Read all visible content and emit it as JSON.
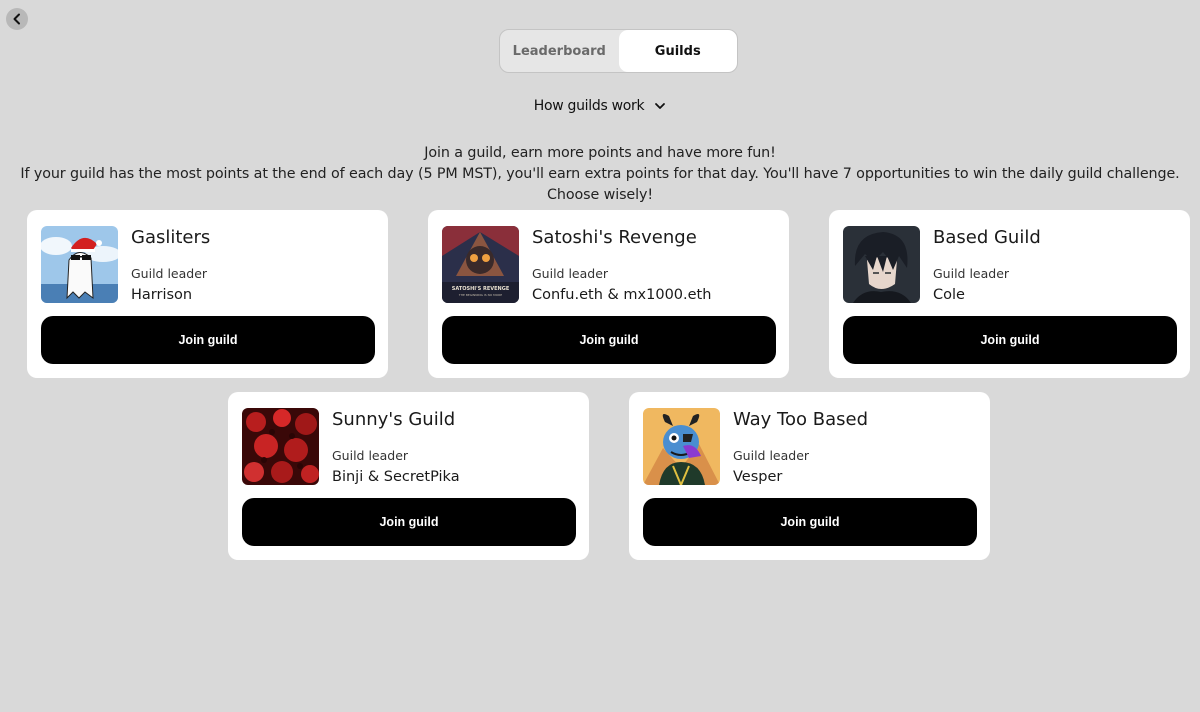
{
  "tabs": [
    {
      "label": "Leaderboard",
      "active": false
    },
    {
      "label": "Guilds",
      "active": true
    }
  ],
  "how_guilds_work": "How guilds work",
  "intro": {
    "line1": "Join a guild, earn more points and have more fun!",
    "line2": "If your guild has the most points at the end of each day (5 PM MST), you'll earn extra points for that day. You'll have 7 opportunities to win the daily guild challenge. Choose wisely!"
  },
  "guilds": [
    {
      "name": "Gasliters",
      "leader_label": "Guild leader",
      "leader": "Harrison",
      "button": "Join guild",
      "avatar": "ghost-santa-avatar"
    },
    {
      "name": "Satoshi's Revenge",
      "leader_label": "Guild leader",
      "leader": "Confu.eth & mx1000.eth",
      "button": "Join guild",
      "avatar": "satoshi-poster-avatar",
      "avatar_text": "SATOSHI'S REVENGE",
      "avatar_subtext": "THE BEGINNING IS NO MORE"
    },
    {
      "name": "Based Guild",
      "leader_label": "Guild leader",
      "leader": "Cole",
      "button": "Join guild",
      "avatar": "anime-character-avatar"
    },
    {
      "name": "Sunny's Guild",
      "leader_label": "Guild leader",
      "leader": "Binji & SecretPika",
      "button": "Join guild",
      "avatar": "red-pattern-avatar"
    },
    {
      "name": "Way Too Based",
      "leader_label": "Guild leader",
      "leader": "Vesper",
      "button": "Join guild",
      "avatar": "horned-creature-avatar"
    }
  ]
}
